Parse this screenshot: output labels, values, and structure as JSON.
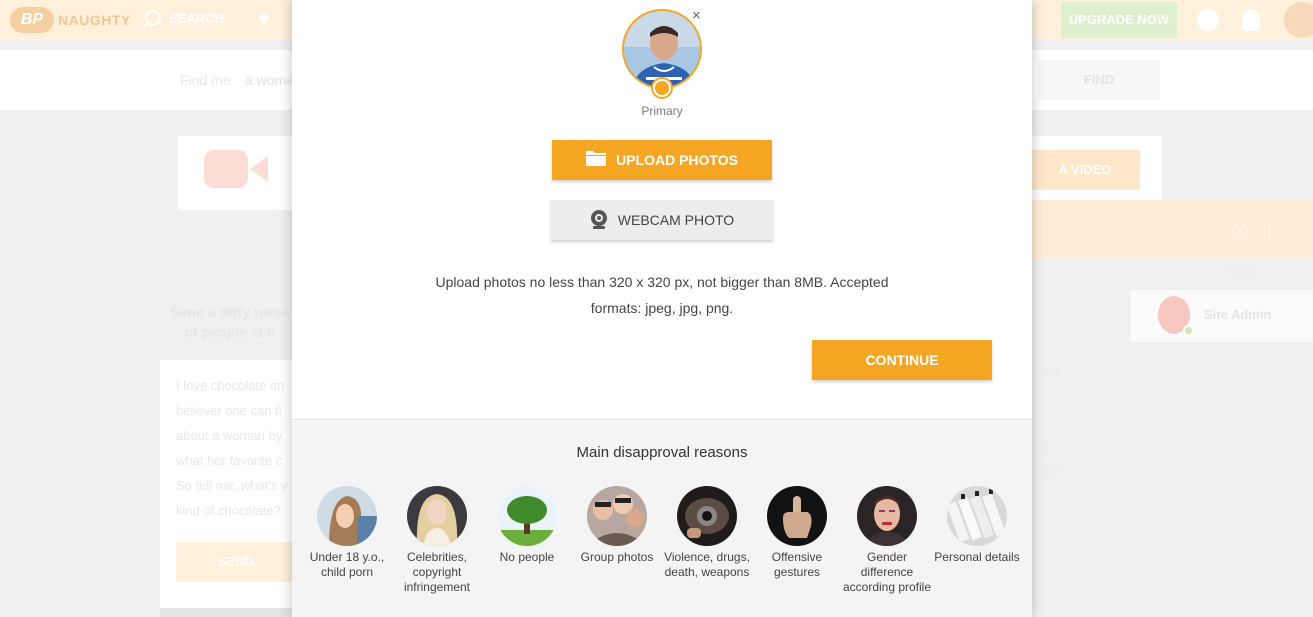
{
  "header": {
    "logo_badge": "BP",
    "logo_text": "NAUGHTY",
    "search_label": "SEARCH",
    "upgrade_label": "UPGRADE NOW"
  },
  "find": {
    "label": "Find me",
    "value": "a woma",
    "button": "FIND"
  },
  "video_card": {
    "button": "A VIDEO"
  },
  "chat": {
    "today": "Today",
    "admin_name": "Site Admin",
    "bits": [
      "age",
      "e",
      "with"
    ]
  },
  "flirty": {
    "line1": "Send a flirty mess",
    "line2": "of people at o"
  },
  "message_lines": [
    "I love chocolate an",
    "believer one can fi",
    "about a woman by",
    "what her favorite c",
    "So tell me, what's y",
    "kind of chocolate?"
  ],
  "send_label": "SEND",
  "modal": {
    "remove_label": "×",
    "primary_label": "Primary",
    "upload_label": "UPLOAD PHOTOS",
    "webcam_label": "WEBCAM PHOTO",
    "info_line1": "Upload photos no less than 320 x 320 px, not bigger than 8MB. Accepted",
    "info_line2": "formats: jpeg, jpg, png.",
    "continue_label": "CONTINUE",
    "reasons_title": "Main disapproval reasons",
    "reasons": [
      {
        "label": "Under 18 y.o., child porn",
        "icon": "child-photo-icon"
      },
      {
        "label": "Celebrities, copyright infringement",
        "icon": "celebrity-photo-icon"
      },
      {
        "label": "No people",
        "icon": "tree-photo-icon"
      },
      {
        "label": "Group photos",
        "icon": "group-photo-icon"
      },
      {
        "label": "Violence, drugs, death, weapons",
        "icon": "gun-photo-icon"
      },
      {
        "label": "Offensive gestures",
        "icon": "middle-finger-photo-icon"
      },
      {
        "label": "Gender difference according profile",
        "icon": "man-makeup-photo-icon"
      },
      {
        "label": "Personal details",
        "icon": "files-photo-icon"
      }
    ]
  },
  "colors": {
    "accent": "#f5a623",
    "webcam_bg": "#ededed",
    "reasons_bg": "#f4f4f4"
  }
}
